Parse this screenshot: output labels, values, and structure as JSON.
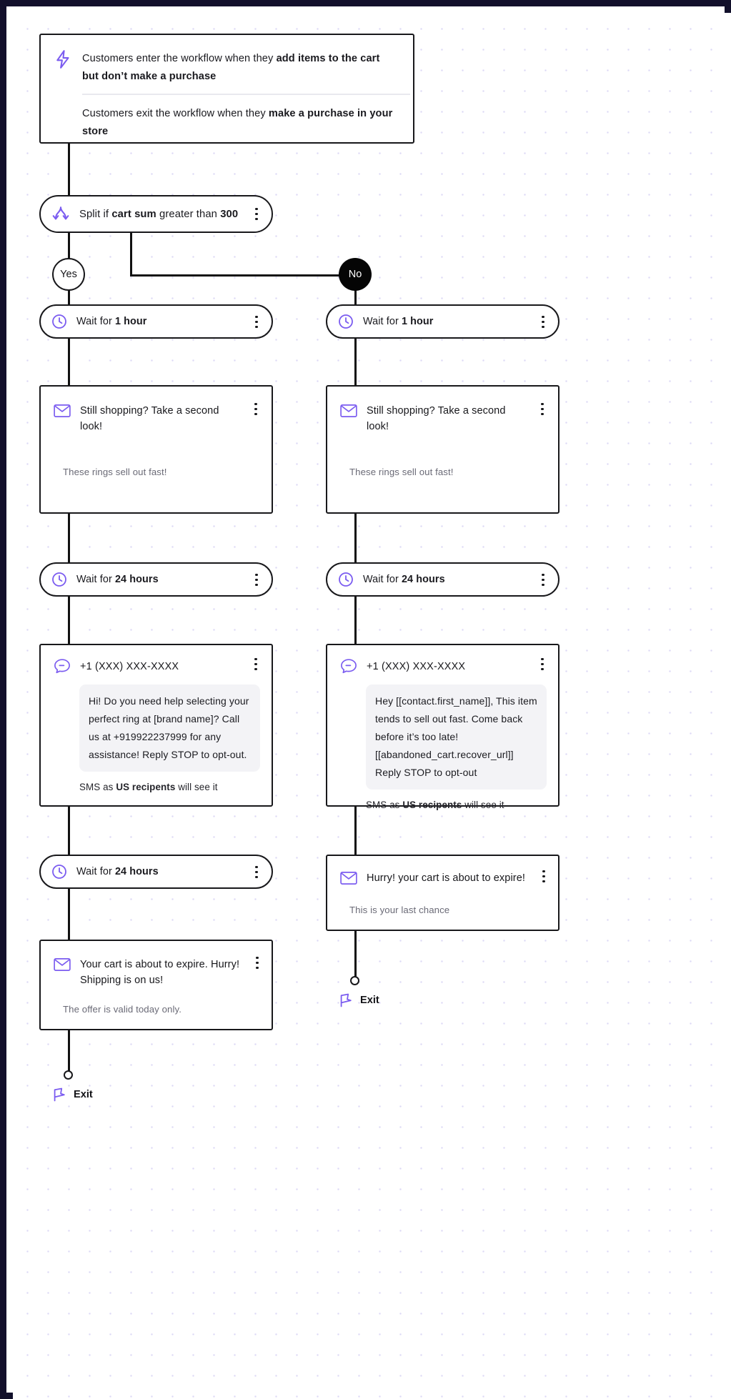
{
  "canvas": {
    "border_color": "#12102b",
    "accent_color": "#7b5cf0",
    "grid_dot_color": "#dcd8f5"
  },
  "trigger": {
    "icon": "lightning-bolt-icon",
    "enter_prefix": "Customers enter the workflow when they ",
    "enter_bold": "add items to the cart but don’t make a purchase",
    "exit_prefix": "Customers exit the workflow when they ",
    "exit_bold": "make a purchase in your store"
  },
  "split": {
    "icon": "split-branch-icon",
    "prefix": "Split if ",
    "bold1": "cart sum",
    "middle": " greater than ",
    "bold2": "300",
    "menu": "kebab-menu"
  },
  "branches": {
    "yes_label": "Yes",
    "no_label": "No"
  },
  "left": {
    "wait1": {
      "icon": "clock-icon",
      "prefix": "Wait for ",
      "bold": "1 hour"
    },
    "email1": {
      "icon": "envelope-icon",
      "subject": "Still shopping? Take a second look!",
      "preview": "These rings sell out fast!"
    },
    "wait2": {
      "icon": "clock-icon",
      "prefix": "Wait for ",
      "bold": "24 hours"
    },
    "sms1": {
      "icon": "sms-chat-icon",
      "phone": "+1  (XXX) XXX-XXXX",
      "body": "Hi! Do you need help selecting your perfect ring at [brand name]? Call us at +919922237999 for any assistance! Reply STOP to opt-out.",
      "footnote_prefix": "SMS as ",
      "footnote_bold": "US recipents",
      "footnote_suffix": " will see it"
    },
    "wait3": {
      "icon": "clock-icon",
      "prefix": "Wait for ",
      "bold": "24 hours"
    },
    "email2": {
      "icon": "envelope-icon",
      "subject": "Your cart is about to expire. Hurry! Shipping is on us!",
      "preview": "The offer is valid today only."
    },
    "exit": {
      "icon": "exit-flag-icon",
      "label": "Exit"
    }
  },
  "right": {
    "wait1": {
      "icon": "clock-icon",
      "prefix": "Wait for ",
      "bold": "1 hour"
    },
    "email1": {
      "icon": "envelope-icon",
      "subject": "Still shopping? Take a second look!",
      "preview": "These rings sell out fast!"
    },
    "wait2": {
      "icon": "clock-icon",
      "prefix": "Wait for ",
      "bold": "24 hours"
    },
    "sms1": {
      "icon": "sms-chat-icon",
      "phone": "+1  (XXX) XXX-XXXX",
      "body": "Hey [[contact.first_name]], This item tends to sell out fast. Come back before it’s too late! [[abandoned_cart.recover_url]] Reply STOP to opt-out",
      "footnote_prefix": "SMS as ",
      "footnote_bold": "US recipents",
      "footnote_suffix": " will see it"
    },
    "email2": {
      "icon": "envelope-icon",
      "subject": "Hurry! your cart is about to expire!",
      "preview": "This is your last chance"
    },
    "exit": {
      "icon": "exit-flag-icon",
      "label": "Exit"
    }
  }
}
